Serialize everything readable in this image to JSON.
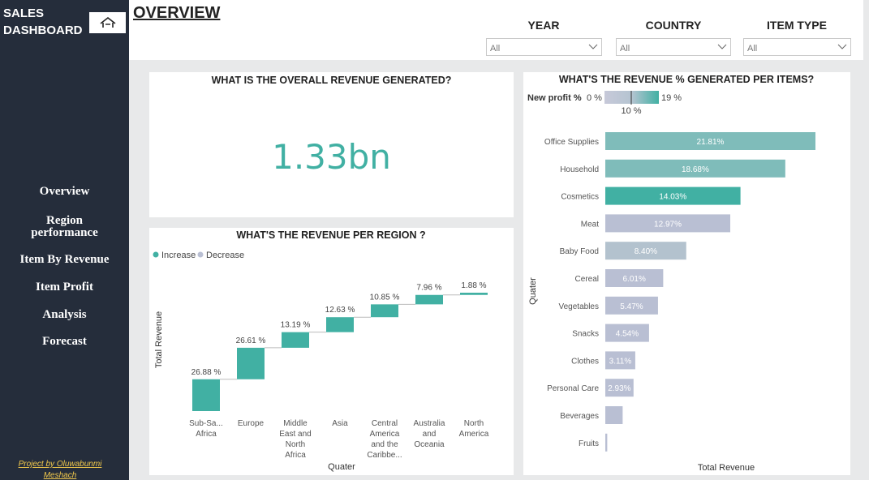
{
  "sidebar": {
    "brand_line1": "SALES",
    "brand_line2": "DASHBOARD",
    "home_icon": "home-icon",
    "nav": [
      {
        "label": "Overview"
      },
      {
        "label": "Region"
      },
      {
        "label": "performance"
      },
      {
        "label": "Item By Revenue"
      },
      {
        "label": "Item Profit"
      },
      {
        "label": "Analysis"
      },
      {
        "label": "Forecast"
      }
    ],
    "credit_line1": "Project by Oluwabunmi",
    "credit_line2": "Meshach"
  },
  "header": {
    "title": "OVERVIEW",
    "filters": [
      {
        "label": "YEAR",
        "value": "All"
      },
      {
        "label": "COUNTRY",
        "value": "All"
      },
      {
        "label": "ITEM TYPE",
        "value": "All"
      }
    ]
  },
  "kpi_card": {
    "title": "WHAT IS THE OVERALL REVENUE GENERATED?",
    "value": "1.33bn"
  },
  "colors": {
    "teal": "#41b0a3",
    "teal_light": "#7fbcba",
    "grey_blue": "#b9bfd3",
    "sidebar": "#252d3b"
  },
  "chart_data": [
    {
      "type": "waterfall",
      "title": "WHAT'S THE REVENUE PER REGION ?",
      "xlabel": "Quater",
      "ylabel": "Total Revenue",
      "legend": [
        "Increase",
        "Decrease"
      ],
      "categories": [
        "Sub-Sa... Africa",
        "Europe",
        "Middle East and North Africa",
        "Asia",
        "Central America and the Caribbe...",
        "Australia and Oceania",
        "North America"
      ],
      "category_lines": [
        [
          "Sub-Sa...",
          "Africa"
        ],
        [
          "Europe"
        ],
        [
          "Middle",
          "East and",
          "North",
          "Africa"
        ],
        [
          "Asia"
        ],
        [
          "Central",
          "America",
          "and the",
          "Caribbe..."
        ],
        [
          "Australia",
          "and",
          "Oceania"
        ],
        [
          "North",
          "America"
        ]
      ],
      "values": [
        26.88,
        26.61,
        13.19,
        12.63,
        10.85,
        7.96,
        1.88
      ],
      "labels": [
        "26.88 %",
        "26.61 %",
        "13.19 %",
        "12.63 %",
        "10.85 %",
        "7.96 %",
        "1.88 %"
      ]
    },
    {
      "type": "bar",
      "orientation": "horizontal",
      "title": "WHAT'S THE REVENUE % GENERATED PER ITEMS?",
      "xlabel": "Total Revenue",
      "ylabel": "Quater",
      "categories": [
        "Office Supplies",
        "Household",
        "Cosmetics",
        "Meat",
        "Baby Food",
        "Cereal",
        "Vegetables",
        "Snacks",
        "Clothes",
        "Personal Care",
        "Beverages",
        "Fruits"
      ],
      "values": [
        21.81,
        18.68,
        14.03,
        12.97,
        8.4,
        6.01,
        5.47,
        4.54,
        3.11,
        2.93,
        1.8,
        0.2
      ],
      "labels": [
        "21.81%",
        "18.68%",
        "14.03%",
        "12.97%",
        "8.40%",
        "6.01%",
        "5.47%",
        "4.54%",
        "3.11%",
        "2.93%",
        "",
        ""
      ],
      "gradient_legend": {
        "label": "New profit %",
        "min": "0 %",
        "mid": "10 %",
        "max": "19 %"
      }
    }
  ]
}
